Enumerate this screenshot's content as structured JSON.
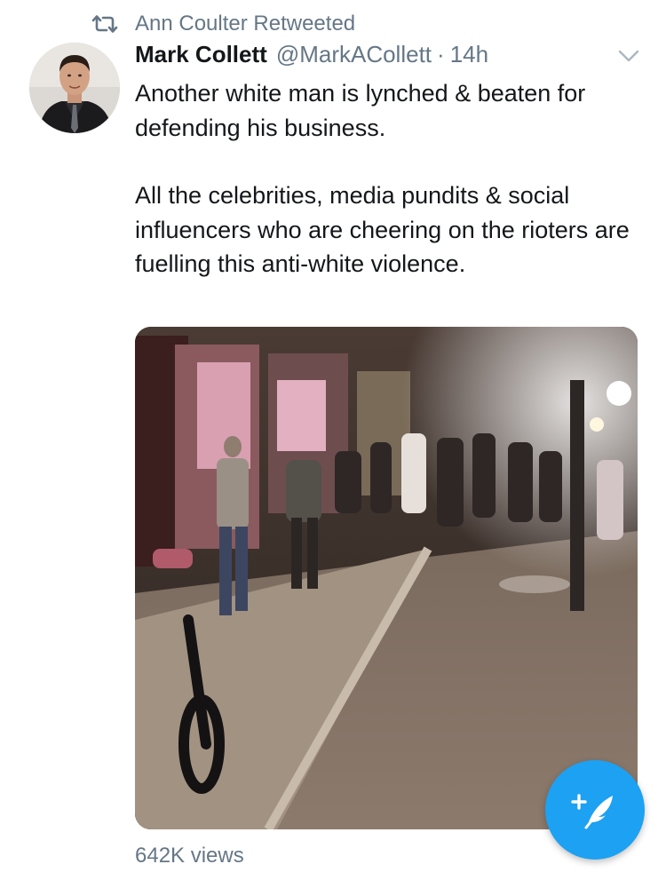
{
  "retweet": {
    "label": "Ann Coulter Retweeted",
    "icon": "retweet-icon"
  },
  "tweet": {
    "display_name": "Mark Collett",
    "handle": "@MarkACollett",
    "separator": "·",
    "time": "14h",
    "text_paragraphs": [
      "Another white man is lynched & beaten for defending his business.",
      "All the celebrities, media pundits & social influencers who are cheering on the rioters are fuelling this anti-white violence."
    ],
    "views": "642K views"
  },
  "icons": {
    "menu": "chevron-down-icon",
    "compose": "compose-feather-icon"
  },
  "colors": {
    "accent": "#1da1f2",
    "secondary_text": "#657786",
    "primary_text": "#14171a"
  }
}
